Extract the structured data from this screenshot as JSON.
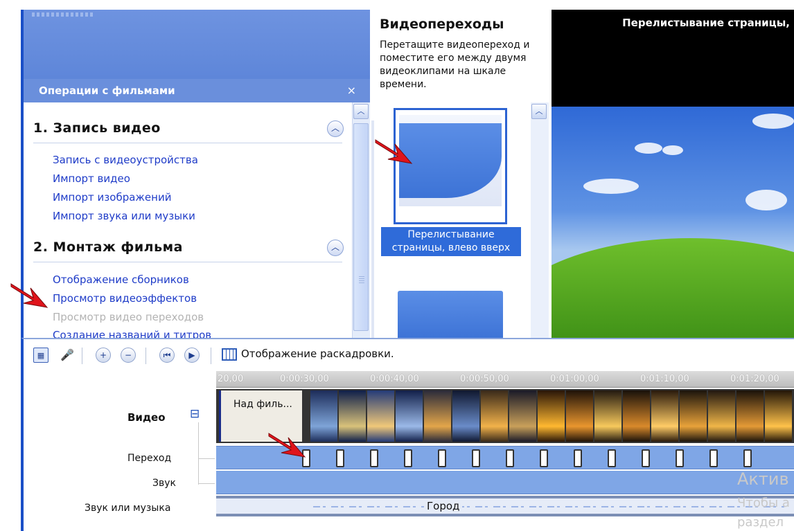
{
  "tasks_pane": {
    "header": "Операции с фильмами",
    "close_glyph": "×",
    "sections": [
      {
        "title": "1. Запись видео",
        "links": [
          "Запись с видеоустройства",
          "Импорт видео",
          "Импорт изображений",
          "Импорт звука или музыки"
        ]
      },
      {
        "title": "2. Монтаж фильма",
        "links": [
          "Отображение сборников",
          "Просмотр видеоэффектов",
          "Просмотр видео переходов",
          "Создание названий и титров"
        ],
        "disabled_index": 2
      }
    ]
  },
  "transitions_pane": {
    "title": "Видеопереходы",
    "description": "Перетащите видеопереход и поместите его между двумя видеоклипами на шкале времени.",
    "selected_item_label": "Перелистывание страницы, влево вверх"
  },
  "preview": {
    "title": "Перелистывание страницы,"
  },
  "timeline": {
    "storyboard_button": "Отображение раскадровки.",
    "ruler_ticks": [
      "20,00",
      "0:00:30,00",
      "0:00:40,00",
      "0:00:50,00",
      "0:01:00,00",
      "0:01:10,00",
      "0:01:20,00"
    ],
    "row_labels": {
      "video": "Видео",
      "transition": "Переход",
      "audio": "Звук",
      "music": "Звук или музыка"
    },
    "expand_glyph": "⊟",
    "title_clip": "Над филь...",
    "music_clip": "Город",
    "transition_marker_count": 14
  },
  "watermark": {
    "line1": "Актив",
    "line2": "Чтобы а",
    "line3": "раздел"
  },
  "colors": {
    "accent": "#1a4fc7",
    "header_blue": "#6a8fdc",
    "link_blue": "#1f3cc8",
    "track_blue": "#7fa6e6",
    "arrow_red": "#e0141b"
  },
  "icons": {
    "toolbar": [
      "storyboard-icon",
      "microphone-icon",
      "zoom-in-icon",
      "zoom-out-icon",
      "rewind-icon",
      "play-icon"
    ]
  }
}
